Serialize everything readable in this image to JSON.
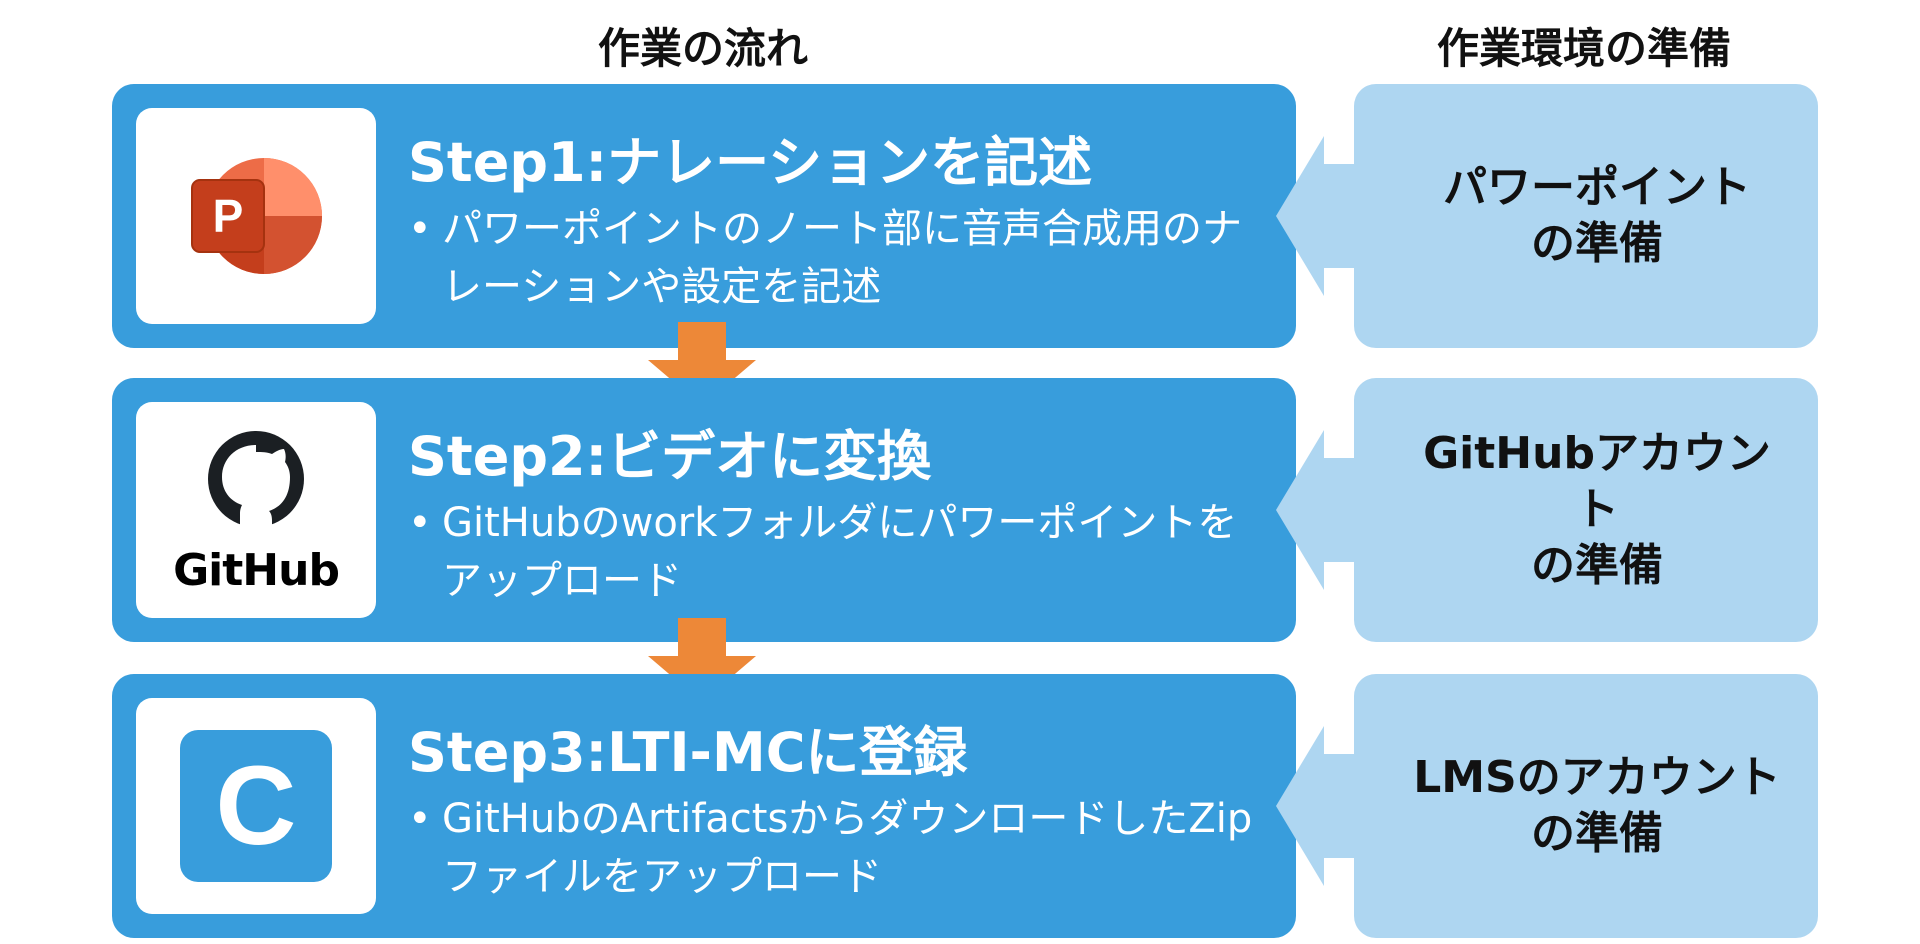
{
  "headers": {
    "flow": "作業の流れ",
    "environment": "作業環境の準備"
  },
  "steps": [
    {
      "title": "Step1:ナレーションを記述",
      "bullet": "•",
      "text": "パワーポイントのノート部に音声合成用のナレーションや設定を記述",
      "icon": "powerpoint-icon",
      "logo_letter": "P"
    },
    {
      "title": "Step2:ビデオに変換",
      "bullet": "•",
      "text": "GitHubのworkフォルダにパワーポイントをアップロード",
      "icon": "github-icon",
      "logo_text": "GitHub"
    },
    {
      "title": "Step3:LTI-MCに登録",
      "bullet": "•",
      "text": "GitHubのArtifactsからダウンロードしたZipファイルをアップロード",
      "icon": "lti-mc-icon",
      "logo_letter": "C"
    }
  ],
  "environment": [
    {
      "line1": "パワーポイント",
      "line2": "の準備"
    },
    {
      "line1": "GitHubアカウント",
      "line2": "の準備"
    },
    {
      "line1": "LMSのアカウント",
      "line2": "の準備"
    }
  ],
  "colors": {
    "step_bg": "#389DDC",
    "env_bg": "#AED6F1",
    "arrow_down": "#ED8838",
    "text_on_step": "#FFFFFF"
  }
}
